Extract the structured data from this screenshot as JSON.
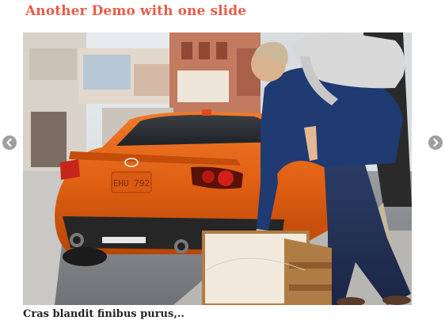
{
  "demo": {
    "title": "Another Demo with one slide",
    "title_color": "#e85c4a"
  },
  "slider": {
    "slides": [
      {
        "image_icon": "photo-orange-car-street",
        "caption": "Cras blandit finibus purus,.."
      }
    ],
    "prev_icon": "chevron-left-icon",
    "next_icon": "chevron-right-icon",
    "arrow_color": "#9e9e9e"
  }
}
